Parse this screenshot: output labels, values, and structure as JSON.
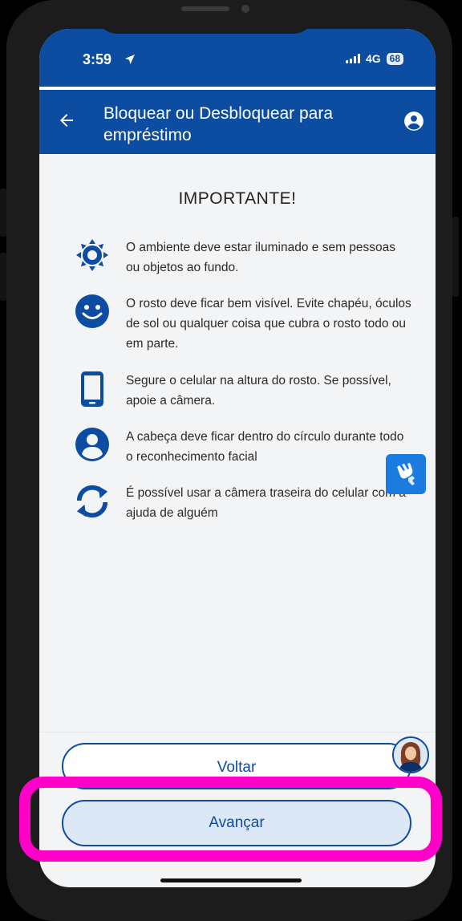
{
  "status_bar": {
    "time": "3:59",
    "network": "4G",
    "battery": "68"
  },
  "appbar": {
    "title": "Bloquear ou Desbloquear para empréstimo"
  },
  "main": {
    "heading": "IMPORTANTE!",
    "items": [
      {
        "icon": "sun-icon",
        "text": "O ambiente deve estar iluminado e sem pessoas ou objetos ao fundo."
      },
      {
        "icon": "smiley-icon",
        "text": "O rosto deve ficar bem visível. Evite chapéu, óculos de sol ou qualquer coisa que cubra o rosto todo ou em parte."
      },
      {
        "icon": "smartphone-icon",
        "text": "Segure o celular na altura do rosto. Se possível, apoie a câmera."
      },
      {
        "icon": "person-circle-icon",
        "text": "A cabeça deve ficar dentro do círculo durante todo o reconhecimento facial"
      },
      {
        "icon": "camera-switch-icon",
        "text": "É possível usar a câmera traseira do celular com a ajuda de alguém"
      }
    ]
  },
  "footer": {
    "back_label": "Voltar",
    "next_label": "Avançar"
  },
  "colors": {
    "primary": "#0c4da2",
    "accent_libras": "#1b7be0",
    "highlight": "#ff00c8"
  }
}
